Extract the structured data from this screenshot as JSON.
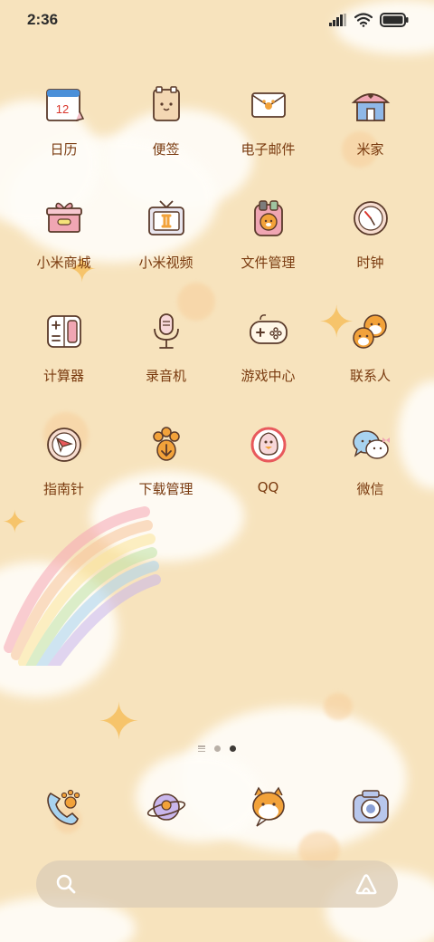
{
  "status_bar": {
    "time": "2:36"
  },
  "apps": [
    {
      "label": "日历",
      "icon": "calendar-icon",
      "day": "12"
    },
    {
      "label": "便签",
      "icon": "notes-icon"
    },
    {
      "label": "电子邮件",
      "icon": "email-icon"
    },
    {
      "label": "米家",
      "icon": "home-icon"
    },
    {
      "label": "小米商城",
      "icon": "gift-box-icon"
    },
    {
      "label": "小米视频",
      "icon": "tv-icon"
    },
    {
      "label": "文件管理",
      "icon": "backpack-icon"
    },
    {
      "label": "时钟",
      "icon": "clock-icon"
    },
    {
      "label": "计算器",
      "icon": "calculator-icon"
    },
    {
      "label": "录音机",
      "icon": "microphone-icon"
    },
    {
      "label": "游戏中心",
      "icon": "gamepad-icon"
    },
    {
      "label": "联系人",
      "icon": "dog-faces-icon"
    },
    {
      "label": "指南针",
      "icon": "compass-icon"
    },
    {
      "label": "下载管理",
      "icon": "paw-download-icon"
    },
    {
      "label": "QQ",
      "icon": "qq-penguin-icon"
    },
    {
      "label": "微信",
      "icon": "wechat-bubbles-icon"
    }
  ],
  "dock": [
    {
      "icon": "phone-paw-icon"
    },
    {
      "icon": "planet-browser-icon"
    },
    {
      "icon": "shiba-message-icon"
    },
    {
      "icon": "camera-icon"
    }
  ],
  "page_indicator": {
    "pages": 2,
    "active_page": 2
  },
  "colors": {
    "label": "#7a3b10",
    "background": "#f7e3bd",
    "icon_outline": "#5a3a2a"
  }
}
